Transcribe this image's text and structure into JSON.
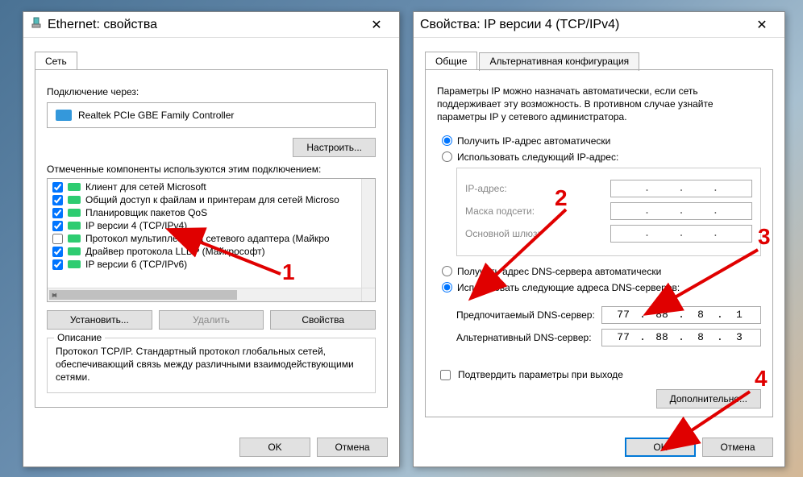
{
  "dlg1": {
    "title": "Ethernet: свойства",
    "tab": "Сеть",
    "connect_label": "Подключение через:",
    "adapter": "Realtek PCIe GBE Family Controller",
    "configure_btn": "Настроить...",
    "components_label": "Отмеченные компоненты используются этим подключением:",
    "components": [
      {
        "checked": true,
        "label": "Клиент для сетей Microsoft"
      },
      {
        "checked": true,
        "label": "Общий доступ к файлам и принтерам для сетей Microso"
      },
      {
        "checked": true,
        "label": "Планировщик пакетов QoS"
      },
      {
        "checked": true,
        "label": "IP версии 4 (TCP/IPv4)"
      },
      {
        "checked": false,
        "label": "Протокол мультиплексора сетевого адаптера (Майкро"
      },
      {
        "checked": true,
        "label": "Драйвер протокола LLDP (Майкрософт)"
      },
      {
        "checked": true,
        "label": "IP версии 6 (TCP/IPv6)"
      }
    ],
    "install_btn": "Установить...",
    "remove_btn": "Удалить",
    "props_btn": "Свойства",
    "desc_legend": "Описание",
    "desc_text": "Протокол TCP/IP. Стандартный протокол глобальных сетей, обеспечивающий связь между различными взаимодействующими сетями.",
    "ok": "OK",
    "cancel": "Отмена"
  },
  "dlg2": {
    "title": "Свойства: IP версии 4 (TCP/IPv4)",
    "tab_general": "Общие",
    "tab_alt": "Альтернативная конфигурация",
    "intro": "Параметры IP можно назначать автоматически, если сеть поддерживает эту возможность. В противном случае узнайте параметры IP у сетевого администратора.",
    "ip_auto": "Получить IP-адрес автоматически",
    "ip_manual": "Использовать следующий IP-адрес:",
    "ip_addr_label": "IP-адрес:",
    "mask_label": "Маска подсети:",
    "gateway_label": "Основной шлюз:",
    "dns_auto": "Получить адрес DNS-сервера автоматически",
    "dns_manual": "Использовать следующие адреса DNS-серверов:",
    "dns_pref_label": "Предпочитаемый DNS-сервер:",
    "dns_alt_label": "Альтернативный DNS-сервер:",
    "dns_pref": [
      "77",
      "88",
      "8",
      "1"
    ],
    "dns_alt": [
      "77",
      "88",
      "8",
      "3"
    ],
    "validate": "Подтвердить параметры при выходе",
    "advanced": "Дополнительно...",
    "ok": "OK",
    "cancel": "Отмена"
  },
  "anno": {
    "n1": "1",
    "n2": "2",
    "n3": "3",
    "n4": "4"
  }
}
